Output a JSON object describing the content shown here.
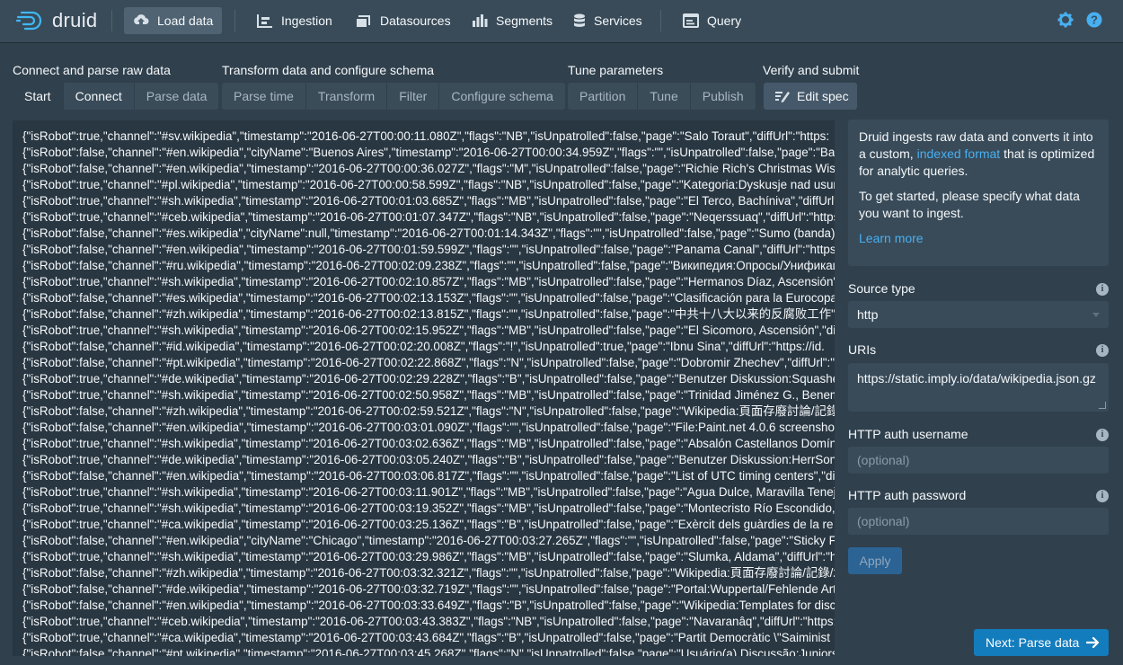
{
  "app": {
    "logo_text": "druid"
  },
  "nav": {
    "load_data": "Load data",
    "ingestion": "Ingestion",
    "datasources": "Datasources",
    "segments": "Segments",
    "services": "Services",
    "query": "Query"
  },
  "steps": {
    "group1": {
      "title": "Connect and parse raw data",
      "items": [
        "Start",
        "Connect",
        "Parse data"
      ]
    },
    "group2": {
      "title": "Transform data and configure schema",
      "items": [
        "Parse time",
        "Transform",
        "Filter",
        "Configure schema"
      ]
    },
    "group3": {
      "title": "Tune parameters",
      "items": [
        "Partition",
        "Tune",
        "Publish"
      ]
    },
    "group4": {
      "title": "Verify and submit",
      "edit_spec": "Edit spec"
    }
  },
  "raw_lines": [
    "{\"isRobot\":true,\"channel\":\"#sv.wikipedia\",\"timestamp\":\"2016-06-27T00:00:11.080Z\",\"flags\":\"NB\",\"isUnpatrolled\":false,\"page\":\"Salo Toraut\",\"diffUrl\":\"https:",
    "{\"isRobot\":false,\"channel\":\"#en.wikipedia\",\"cityName\":\"Buenos Aires\",\"timestamp\":\"2016-06-27T00:00:34.959Z\",\"flags\":\"\",\"isUnpatrolled\":false,\"page\":\"Bailando",
    "{\"isRobot\":false,\"channel\":\"#en.wikipedia\",\"timestamp\":\"2016-06-27T00:00:36.027Z\",\"flags\":\"M\",\"isUnpatrolled\":false,\"page\":\"Richie Rich's Christmas Wish\"",
    "{\"isRobot\":true,\"channel\":\"#pl.wikipedia\",\"timestamp\":\"2016-06-27T00:00:58.599Z\",\"flags\":\"NB\",\"isUnpatrolled\":false,\"page\":\"Kategoria:Dyskusje nad usuni",
    "{\"isRobot\":true,\"channel\":\"#sh.wikipedia\",\"timestamp\":\"2016-06-27T00:01:03.685Z\",\"flags\":\"MB\",\"isUnpatrolled\":false,\"page\":\"El Terco, Bachíniva\",\"diffUrl\"",
    "{\"isRobot\":true,\"channel\":\"#ceb.wikipedia\",\"timestamp\":\"2016-06-27T00:01:07.347Z\",\"flags\":\"NB\",\"isUnpatrolled\":false,\"page\":\"Neqerssuaq\",\"diffUrl\":\"https",
    "{\"isRobot\":false,\"channel\":\"#es.wikipedia\",\"cityName\":null,\"timestamp\":\"2016-06-27T00:01:14.343Z\",\"flags\":\"\",\"isUnpatrolled\":false,\"page\":\"Sumo (banda)\"",
    "{\"isRobot\":false,\"channel\":\"#en.wikipedia\",\"timestamp\":\"2016-06-27T00:01:59.599Z\",\"flags\":\"\",\"isUnpatrolled\":false,\"page\":\"Panama Canal\",\"diffUrl\":\"https",
    "{\"isRobot\":false,\"channel\":\"#ru.wikipedia\",\"timestamp\":\"2016-06-27T00:02:09.238Z\",\"flags\":\"\",\"isUnpatrolled\":false,\"page\":\"Википедия:Опросы/Унификация",
    "{\"isRobot\":true,\"channel\":\"#sh.wikipedia\",\"timestamp\":\"2016-06-27T00:02:10.857Z\",\"flags\":\"MB\",\"isUnpatrolled\":false,\"page\":\"Hermanos Díaz, Ascensión\"",
    "{\"isRobot\":false,\"channel\":\"#es.wikipedia\",\"timestamp\":\"2016-06-27T00:02:13.153Z\",\"flags\":\"\",\"isUnpatrolled\":false,\"page\":\"Clasificación para la Eurocopa",
    "{\"isRobot\":false,\"channel\":\"#zh.wikipedia\",\"timestamp\":\"2016-06-27T00:02:13.815Z\",\"flags\":\"\",\"isUnpatrolled\":false,\"page\":\"中共十八大以来的反腐败工作\"",
    "{\"isRobot\":true,\"channel\":\"#sh.wikipedia\",\"timestamp\":\"2016-06-27T00:02:15.952Z\",\"flags\":\"MB\",\"isUnpatrolled\":false,\"page\":\"El Sicomoro, Ascensión\",\"di",
    "{\"isRobot\":false,\"channel\":\"#id.wikipedia\",\"timestamp\":\"2016-06-27T00:02:20.008Z\",\"flags\":\"!\",\"isUnpatrolled\":true,\"page\":\"Ibnu Sina\",\"diffUrl\":\"https://id.",
    "{\"isRobot\":false,\"channel\":\"#pt.wikipedia\",\"timestamp\":\"2016-06-27T00:02:22.868Z\",\"flags\":\"N\",\"isUnpatrolled\":false,\"page\":\"Dobromir Zhechev\",\"diffUrl\":\"",
    "{\"isRobot\":true,\"channel\":\"#de.wikipedia\",\"timestamp\":\"2016-06-27T00:02:29.228Z\",\"flags\":\"B\",\"isUnpatrolled\":false,\"page\":\"Benutzer Diskussion:Squasher",
    "{\"isRobot\":true,\"channel\":\"#sh.wikipedia\",\"timestamp\":\"2016-06-27T00:02:50.958Z\",\"flags\":\"MB\",\"isUnpatrolled\":false,\"page\":\"Trinidad Jiménez G., Benemér",
    "{\"isRobot\":false,\"channel\":\"#zh.wikipedia\",\"timestamp\":\"2016-06-27T00:02:59.521Z\",\"flags\":\"N\",\"isUnpatrolled\":false,\"page\":\"Wikipedia:頁面存廢討論/記錄",
    "{\"isRobot\":false,\"channel\":\"#en.wikipedia\",\"timestamp\":\"2016-06-27T00:03:01.090Z\",\"flags\":\"\",\"isUnpatrolled\":false,\"page\":\"File:Paint.net 4.0.6 screenshot",
    "{\"isRobot\":true,\"channel\":\"#sh.wikipedia\",\"timestamp\":\"2016-06-27T00:03:02.636Z\",\"flags\":\"MB\",\"isUnpatrolled\":false,\"page\":\"Absalón Castellanos Domíng",
    "{\"isRobot\":true,\"channel\":\"#de.wikipedia\",\"timestamp\":\"2016-06-27T00:03:05.240Z\",\"flags\":\"B\",\"isUnpatrolled\":false,\"page\":\"Benutzer Diskussion:HerrSonn",
    "{\"isRobot\":false,\"channel\":\"#en.wikipedia\",\"timestamp\":\"2016-06-27T00:03:06.817Z\",\"flags\":\"\",\"isUnpatrolled\":false,\"page\":\"List of UTC timing centers\",\"di",
    "{\"isRobot\":true,\"channel\":\"#sh.wikipedia\",\"timestamp\":\"2016-06-27T00:03:11.901Z\",\"flags\":\"MB\",\"isUnpatrolled\":false,\"page\":\"Agua Dulce, Maravilla Tenejap",
    "{\"isRobot\":true,\"channel\":\"#sh.wikipedia\",\"timestamp\":\"2016-06-27T00:03:19.352Z\",\"flags\":\"MB\",\"isUnpatrolled\":false,\"page\":\"Montecristo Río Escondido, C",
    "{\"isRobot\":true,\"channel\":\"#ca.wikipedia\",\"timestamp\":\"2016-06-27T00:03:25.136Z\",\"flags\":\"B\",\"isUnpatrolled\":false,\"page\":\"Exèrcit dels guàrdies de la re",
    "{\"isRobot\":false,\"channel\":\"#en.wikipedia\",\"cityName\":\"Chicago\",\"timestamp\":\"2016-06-27T00:03:27.265Z\",\"flags\":\"\",\"isUnpatrolled\":false,\"page\":\"Sticky Fi",
    "{\"isRobot\":true,\"channel\":\"#sh.wikipedia\",\"timestamp\":\"2016-06-27T00:03:29.986Z\",\"flags\":\"MB\",\"isUnpatrolled\":false,\"page\":\"Slumka, Aldama\",\"diffUrl\":\"htt",
    "{\"isRobot\":false,\"channel\":\"#zh.wikipedia\",\"timestamp\":\"2016-06-27T00:03:32.321Z\",\"flags\":\"\",\"isUnpatrolled\":false,\"page\":\"Wikipedia:頁面存廢討論/記錄/20",
    "{\"isRobot\":false,\"channel\":\"#de.wikipedia\",\"timestamp\":\"2016-06-27T00:03:32.719Z\",\"flags\":\"\",\"isUnpatrolled\":false,\"page\":\"Portal:Wuppertal/Fehlende Arti",
    "{\"isRobot\":false,\"channel\":\"#en.wikipedia\",\"timestamp\":\"2016-06-27T00:03:33.649Z\",\"flags\":\"B\",\"isUnpatrolled\":false,\"page\":\"Wikipedia:Templates for discuss",
    "{\"isRobot\":true,\"channel\":\"#ceb.wikipedia\",\"timestamp\":\"2016-06-27T00:03:43.383Z\",\"flags\":\"NB\",\"isUnpatrolled\":false,\"page\":\"Navaranâq\",\"diffUrl\":\"https:",
    "{\"isRobot\":true,\"channel\":\"#ca.wikipedia\",\"timestamp\":\"2016-06-27T00:03:43.684Z\",\"flags\":\"B\",\"isUnpatrolled\":false,\"page\":\"Partit Democràtic \\\"Saiminist",
    "{\"isRobot\":false,\"channel\":\"#pt.wikipedia\",\"timestamp\":\"2016-06-27T00:03:45.268Z\",\"flags\":\"N\",\"isUnpatrolled\":false,\"page\":\"Usuário(a) Discussão:Juniorso"
  ],
  "info": {
    "p1_before": "Druid ingests raw data and converts it into a custom, ",
    "p1_link": "indexed format",
    "p1_after": " that is optimized for analytic queries.",
    "p2": "To get started, please specify what data you want to ingest.",
    "learn_more": "Learn more"
  },
  "form": {
    "source_type_label": "Source type",
    "source_type_value": "http",
    "uris_label": "URIs",
    "uris_value": "https://static.imply.io/data/wikipedia.json.gz",
    "username_label": "HTTP auth username",
    "username_placeholder": "(optional)",
    "password_label": "HTTP auth password",
    "password_placeholder": "(optional)",
    "apply": "Apply"
  },
  "next_button": "Next: Parse data",
  "colors": {
    "accent": "#137cbd",
    "link": "#48aff0",
    "background": "#30404d",
    "navbar": "#394b59"
  },
  "icons": {
    "info": "info-icon",
    "settings": "gear-icon",
    "help": "help-icon"
  }
}
